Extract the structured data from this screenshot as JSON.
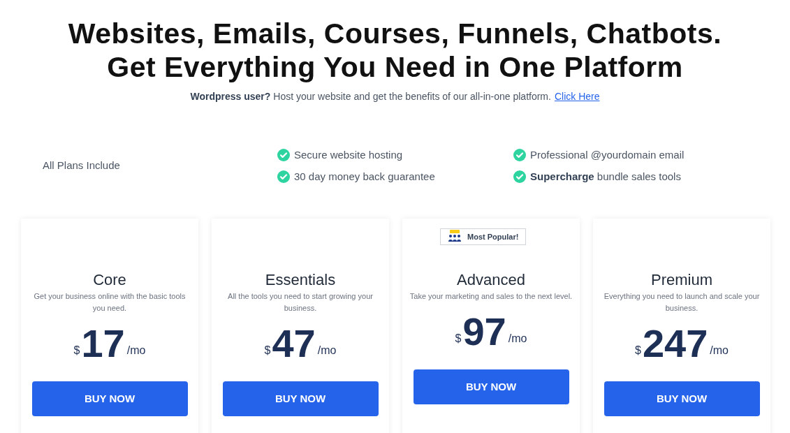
{
  "headline": [
    "Websites, Emails, Courses, Funnels, Chatbots.",
    "Get Everything You Need in One Platform"
  ],
  "subtitle": {
    "text": "**Wordpress user?** Host your website and get the benefits of our all-in-one platform.",
    "link": "Click Here"
  },
  "includes": {
    "label": "All Plans Include",
    "items": [
      {
        "text": "Secure website hosting"
      },
      {
        "text": "Professional @yourdomain email"
      },
      {
        "text": "30 day money back guarantee"
      },
      {
        "text": "**Supercharge** bundle sales tools"
      }
    ]
  },
  "plans": [
    {
      "name": "Core",
      "description": "Get your business online with the basic tools you need.",
      "currency": "$",
      "price": "17",
      "period": "/mo",
      "button": "BUY NOW"
    },
    {
      "name": "Essentials",
      "description": "All the tools you need to start growing your business.",
      "currency": "$",
      "price": "47",
      "period": "/mo",
      "button": "BUY NOW"
    },
    {
      "name": "Advanced",
      "badge": "Most Popular!",
      "description": "Take your marketing and sales to the next level.",
      "currency": "$",
      "price": "97",
      "period": "/mo",
      "button": "BUY NOW"
    },
    {
      "name": "Premium",
      "description": "Everything you need to launch and scale your business.",
      "currency": "$",
      "price": "247",
      "period": "/mo",
      "button": "BUY NOW"
    }
  ]
}
